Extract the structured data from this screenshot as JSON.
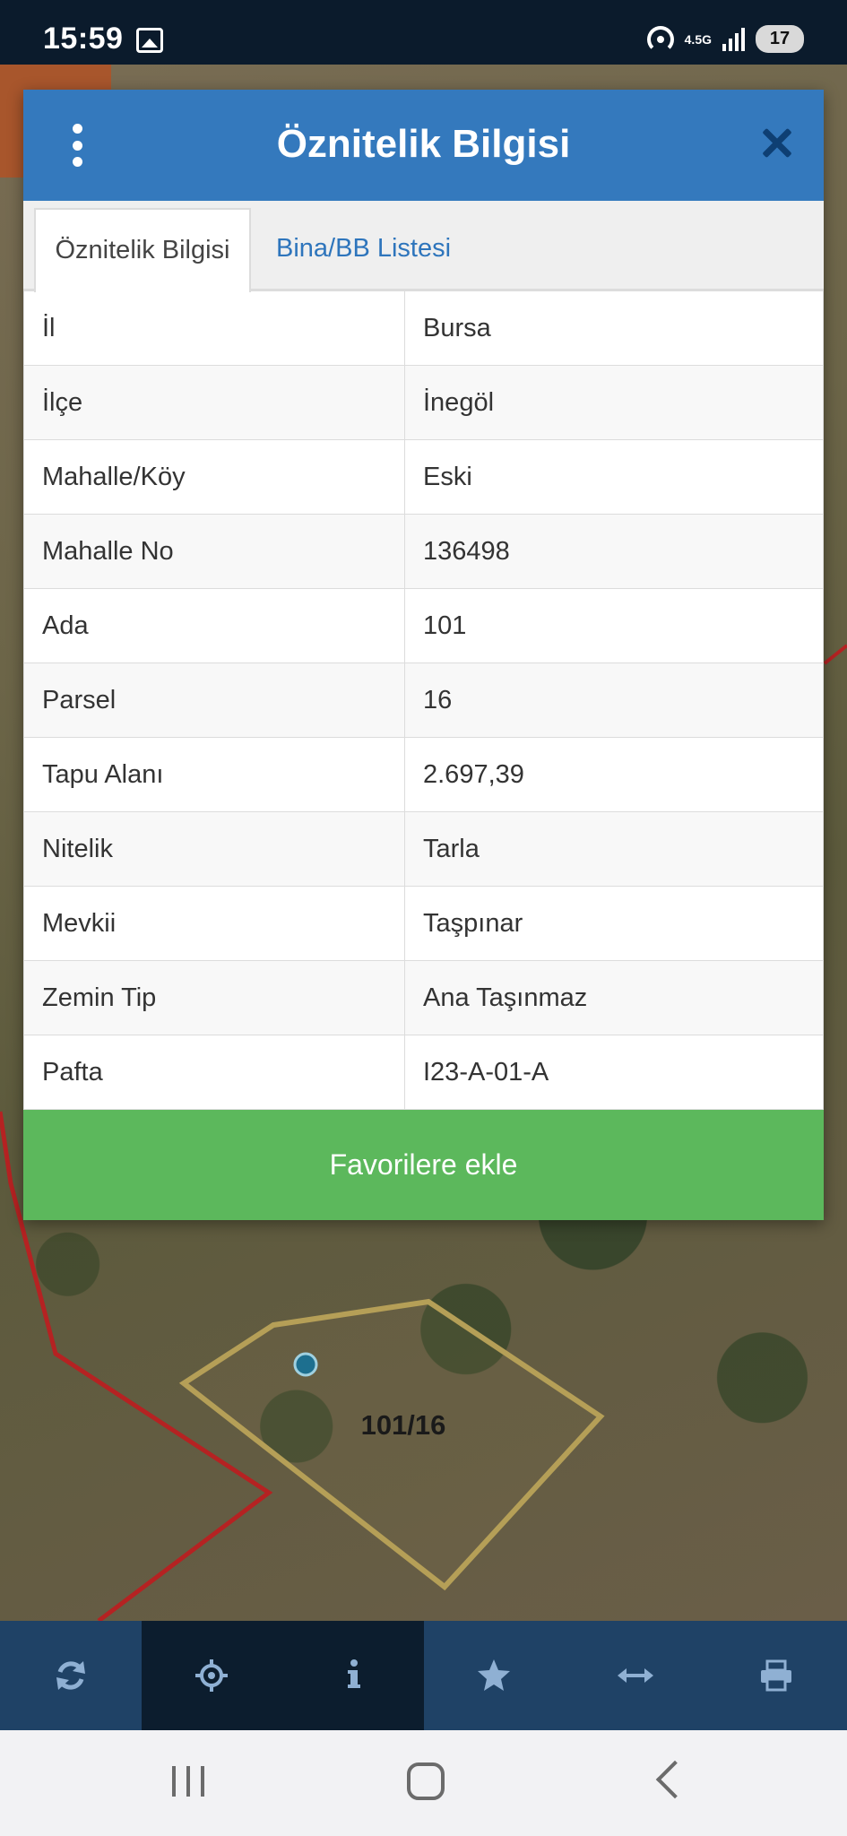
{
  "status_bar": {
    "time": "15:59",
    "network": "4.5G",
    "battery": "17"
  },
  "dialog": {
    "title": "Öznitelik Bilgisi",
    "tabs": [
      {
        "label": "Öznitelik Bilgisi",
        "active": true
      },
      {
        "label": "Bina/BB Listesi",
        "active": false
      }
    ],
    "rows": [
      {
        "key": "İl",
        "value": "Bursa"
      },
      {
        "key": "İlçe",
        "value": "İnegöl"
      },
      {
        "key": "Mahalle/Köy",
        "value": "Eski"
      },
      {
        "key": "Mahalle No",
        "value": "136498"
      },
      {
        "key": "Ada",
        "value": "101"
      },
      {
        "key": "Parsel",
        "value": "16"
      },
      {
        "key": "Tapu Alanı",
        "value": "2.697,39"
      },
      {
        "key": "Nitelik",
        "value": "Tarla"
      },
      {
        "key": "Mevkii",
        "value": "Taşpınar"
      },
      {
        "key": "Zemin Tip",
        "value": "Ana Taşınmaz"
      },
      {
        "key": "Pafta",
        "value": "I23-A-01-A"
      }
    ],
    "favorite_label": "Favorilere ekle"
  },
  "map": {
    "parcel_label": "101/16"
  },
  "toolbar": {
    "items": [
      {
        "icon": "refresh-icon"
      },
      {
        "icon": "locate-icon",
        "active": true
      },
      {
        "icon": "info-icon",
        "active": true
      },
      {
        "icon": "star-icon"
      },
      {
        "icon": "measure-icon"
      },
      {
        "icon": "print-icon"
      }
    ]
  },
  "colors": {
    "header": "#3479bd",
    "tab_link": "#2e75bc",
    "favorite_button": "#5cb85c",
    "toolbar": "#1f4266",
    "toolbar_active": "#0c1d2e",
    "parcel_outline": "#b59f57",
    "boundary": "#b52222"
  }
}
